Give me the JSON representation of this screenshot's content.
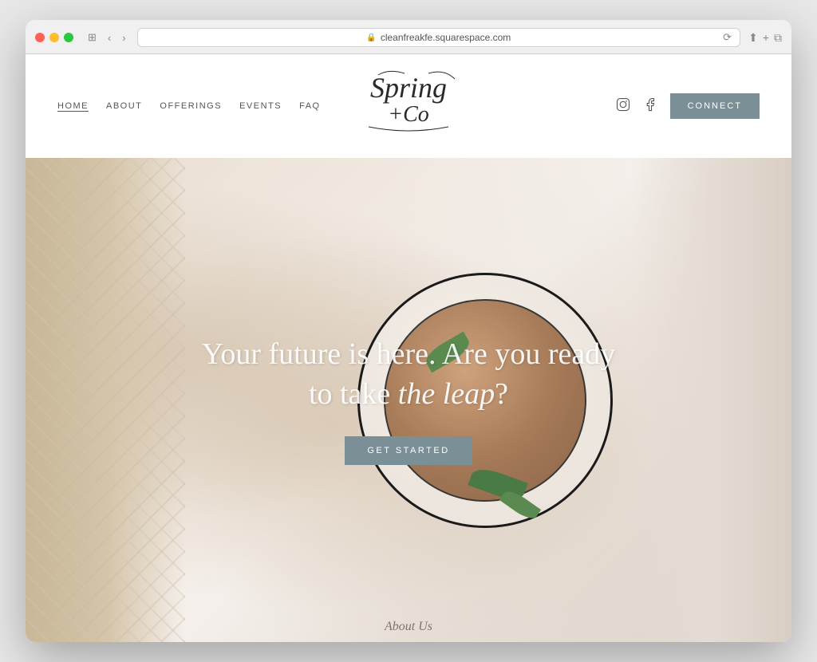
{
  "browser": {
    "url": "cleanfreakfe.squarespace.com",
    "reload_label": "⟳"
  },
  "nav": {
    "links": [
      {
        "id": "home",
        "label": "HOME",
        "active": true
      },
      {
        "id": "about",
        "label": "ABOUT",
        "active": false
      },
      {
        "id": "offerings",
        "label": "OFFERINGS",
        "active": false
      },
      {
        "id": "events",
        "label": "EVENTS",
        "active": false
      },
      {
        "id": "faq",
        "label": "FAQ",
        "active": false
      }
    ],
    "logo": "Spring + Co",
    "connect_label": "CONNeCT"
  },
  "hero": {
    "headline_1": "Your future is here. Are you ready",
    "headline_2": "to take ",
    "headline_italic": "the leap",
    "headline_3": "?",
    "cta_label": "GET STARTED"
  },
  "footer_hint": {
    "label": "About Us"
  },
  "colors": {
    "connect_bg": "#7a8f96",
    "get_started_bg": "#7a8f96",
    "nav_active": "#555555",
    "logo_color": "#2a2a2a"
  }
}
